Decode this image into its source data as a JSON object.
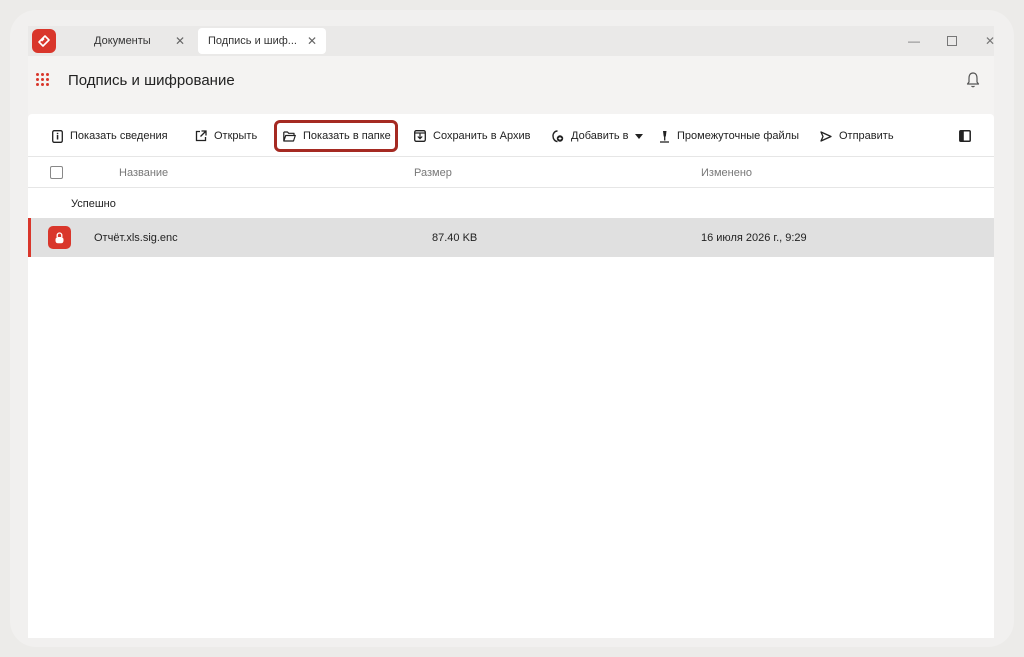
{
  "titlebar": {
    "tabs": [
      {
        "label": "Документы",
        "active": false
      },
      {
        "label": "Подпись и шиф...",
        "active": true
      }
    ],
    "close_glyph": "✕",
    "window_controls": {
      "minimize": "—",
      "maximize": "☐",
      "close": "✕"
    }
  },
  "header": {
    "title": "Подпись и шифрование",
    "menu_icon": "grid-menu-icon",
    "notification_icon": "bell-icon"
  },
  "toolbar": {
    "items": [
      {
        "label": "Показать сведения",
        "icon": "info-doc-icon"
      },
      {
        "label": "Открыть",
        "icon": "external-link-icon"
      },
      {
        "label": "Показать в папке",
        "icon": "folder-open-icon",
        "highlighted": true
      },
      {
        "label": "Сохранить в Архив",
        "icon": "archive-save-icon"
      },
      {
        "label": "Добавить в",
        "icon": "add-shield-icon",
        "dropdown": true
      },
      {
        "label": "Промежуточные файлы",
        "icon": "pin-icon"
      },
      {
        "label": "Отправить",
        "icon": "send-icon"
      }
    ],
    "panel_toggle_icon": "sidebar-panel-icon"
  },
  "table": {
    "columns": [
      "Название",
      "Размер",
      "Изменено"
    ],
    "groups": [
      {
        "label": "Успешно",
        "rows": [
          {
            "name": "Отчёт.xls.sig.enc",
            "size": "87.40 KB",
            "modified": "16 июля 2026 г., 9:29",
            "selected": true,
            "icon": "encrypted-file-icon"
          }
        ]
      }
    ]
  },
  "colors": {
    "accent": "#d9362b",
    "highlight_border": "#a52a22",
    "selected_row": "#e0e0e0"
  }
}
